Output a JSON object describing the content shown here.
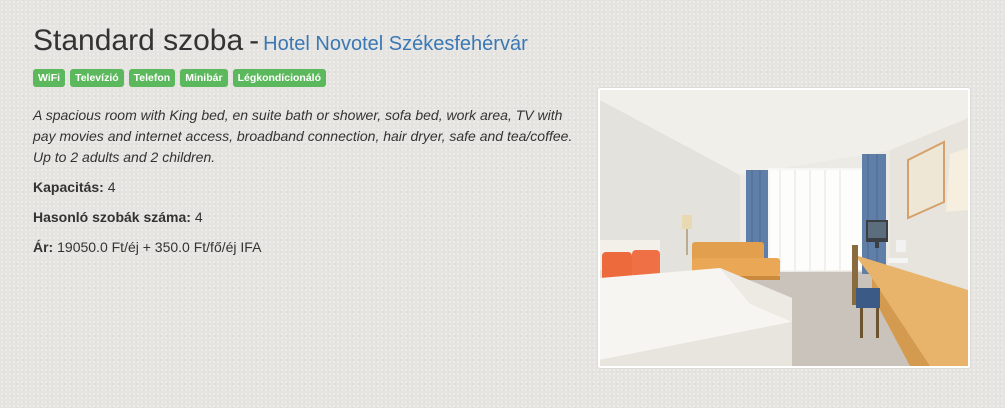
{
  "room": {
    "name": "Standard szoba",
    "separator": "-",
    "hotel": "Hotel Novotel Székesfehérvár"
  },
  "amenities": [
    "WiFi",
    "Televízió",
    "Telefon",
    "Minibár",
    "Légkondícionáló"
  ],
  "description": "A spacious room with King bed, en suite bath or shower, sofa bed, work area, TV with pay movies and internet access, broadband connection, hair dryer, safe and tea/coffee. Up to 2 adults and 2 children.",
  "capacity": {
    "label": "Kapacitás:",
    "value": "4"
  },
  "similar_rooms": {
    "label": "Hasonló szobák száma:",
    "value": "4"
  },
  "price": {
    "label": "Ár:",
    "value": "19050.0 Ft/éj + 350.0 Ft/fő/éj IFA"
  },
  "colors": {
    "badge": "#5cb85c",
    "link": "#3a78b5",
    "background": "#e6e4e0"
  }
}
